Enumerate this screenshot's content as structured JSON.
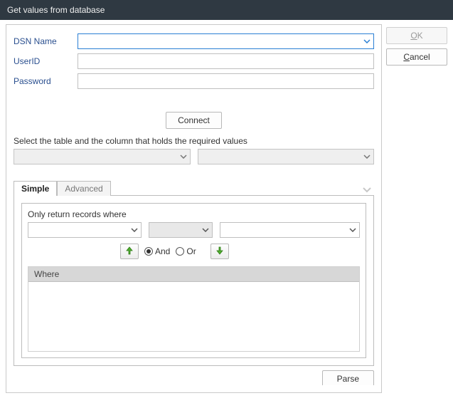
{
  "window": {
    "title": "Get values from database"
  },
  "buttons": {
    "ok_underline": "O",
    "ok_rest": "K",
    "cancel_underline": "C",
    "cancel_rest": "ancel",
    "connect": "Connect",
    "parse": "Parse"
  },
  "form": {
    "dsn_label": "DSN Name",
    "userid_label": "UserID",
    "password_label": "Password",
    "dsn_value": "",
    "userid_value": "",
    "password_value": ""
  },
  "instructions": {
    "select_table": "Select the table and the column that holds the required values"
  },
  "tabs": {
    "simple": "Simple",
    "advanced": "Advanced",
    "active": "simple"
  },
  "filter": {
    "heading": "Only return records where",
    "and_label": "And",
    "or_label": "Or",
    "selected": "and",
    "where_header": "Where"
  }
}
